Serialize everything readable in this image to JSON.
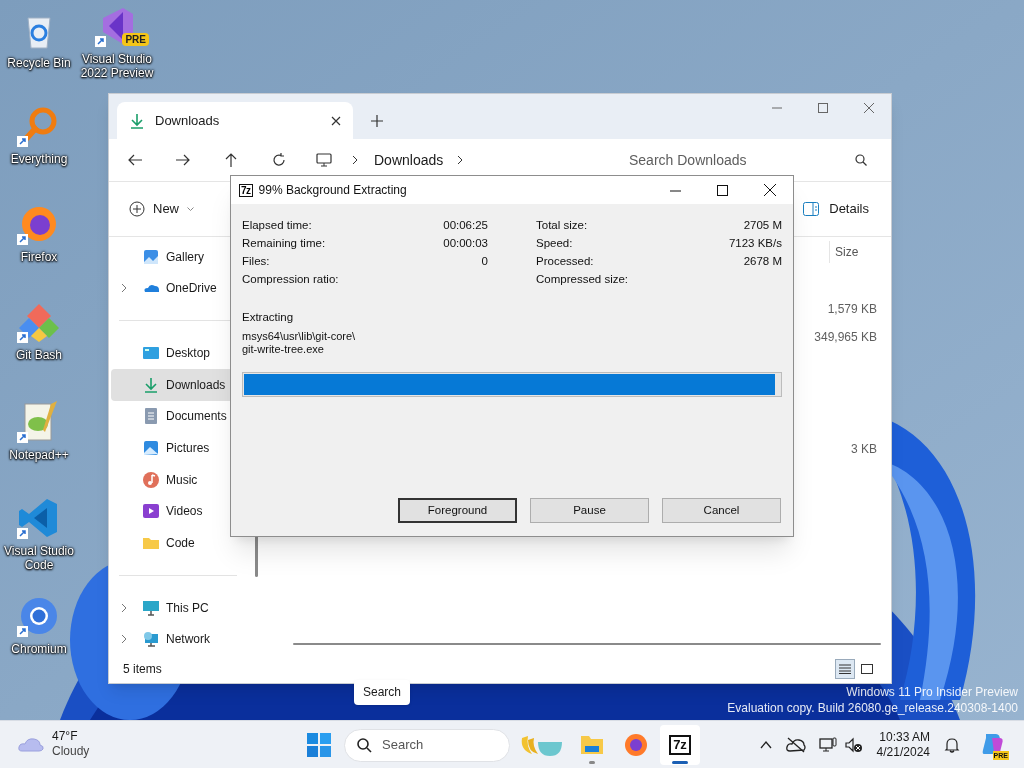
{
  "desktop": {
    "icons": [
      {
        "kind": "recycle",
        "label": "Recycle Bin"
      },
      {
        "kind": "vs",
        "label": "Visual Studio 2022 Preview",
        "badge": "PRE"
      },
      {
        "kind": "everything",
        "label": "Everything"
      },
      {
        "kind": "firefox",
        "label": "Firefox"
      },
      {
        "kind": "gitbash",
        "label": "Git Bash"
      },
      {
        "kind": "notepad",
        "label": "Notepad++"
      },
      {
        "kind": "vscode",
        "label": "Visual Studio Code"
      },
      {
        "kind": "chromium",
        "label": "Chromium"
      }
    ],
    "watermark": [
      "Windows 11 Pro Insider Preview",
      "Evaluation copy. Build 26080.ge_release.240308-1400"
    ],
    "tooltip": "Search"
  },
  "explorer": {
    "tab": {
      "label": "Downloads"
    },
    "address": {
      "crumb": "Downloads"
    },
    "search": {
      "placeholder": "Search Downloads"
    },
    "toolbar": {
      "new_label": "New",
      "view_label": "Details"
    },
    "nav_sections": [
      {
        "items": [
          {
            "kind": "gallery",
            "label": "Gallery",
            "expandable": false,
            "selected": false
          },
          {
            "kind": "onedrive",
            "label": "OneDrive",
            "expandable": true,
            "selected": false
          }
        ]
      },
      {
        "items": [
          {
            "kind": "desktop",
            "label": "Desktop",
            "expandable": false,
            "selected": false
          },
          {
            "kind": "downloads",
            "label": "Downloads",
            "expandable": false,
            "selected": true
          },
          {
            "kind": "documents",
            "label": "Documents",
            "expandable": false,
            "selected": false
          },
          {
            "kind": "pictures",
            "label": "Pictures",
            "expandable": false,
            "selected": false
          },
          {
            "kind": "music",
            "label": "Music",
            "expandable": false,
            "selected": false
          },
          {
            "kind": "videos",
            "label": "Videos",
            "expandable": false,
            "selected": false
          },
          {
            "kind": "folder",
            "label": "Code",
            "expandable": false,
            "selected": false
          }
        ]
      },
      {
        "items": [
          {
            "kind": "pc",
            "label": "This PC",
            "expandable": true,
            "selected": false
          },
          {
            "kind": "network",
            "label": "Network",
            "expandable": true,
            "selected": false
          }
        ]
      }
    ],
    "columns": [
      "Size"
    ],
    "rows": [
      {},
      {
        "size": "1,579 KB"
      },
      {
        "size": "349,965 KB"
      },
      {},
      {},
      {},
      {
        "size": "3 KB"
      }
    ],
    "status": "5 items"
  },
  "dialog": {
    "icon_text": "7z",
    "title": "99% Background Extracting",
    "stats_left": [
      {
        "label": "Elapsed time:",
        "value": "00:06:25"
      },
      {
        "label": "Remaining time:",
        "value": "00:00:03"
      },
      {
        "label": "Files:",
        "value": "0"
      },
      {
        "label": "Compression ratio:"
      }
    ],
    "stats_right": [
      {
        "label": "Total size:",
        "value": "2705 M"
      },
      {
        "label": "Speed:",
        "value": "7123 KB/s"
      },
      {
        "label": "Processed:",
        "value": "2678 M"
      },
      {
        "label": "Compressed size:"
      }
    ],
    "section_label": "Extracting",
    "path_lines": [
      "msys64\\usr\\lib\\git-core\\",
      "git-write-tree.exe"
    ],
    "progress": {
      "level": 0.99
    },
    "buttons": [
      {
        "label": "Foreground",
        "default": true
      },
      {
        "label": "Pause",
        "default": false
      },
      {
        "label": "Cancel",
        "default": false
      }
    ]
  },
  "taskbar": {
    "weather": {
      "temp": "47°F",
      "condition": "Cloudy"
    },
    "search": {
      "placeholder": "Search"
    },
    "apps": [
      {
        "kind": "widget",
        "active": false,
        "running": false
      },
      {
        "kind": "explorer",
        "active": false,
        "running": true
      },
      {
        "kind": "firefox",
        "active": false,
        "running": false
      },
      {
        "kind": "sevenzip",
        "text": "7z",
        "active": true,
        "running": true
      }
    ],
    "time": "10:33 AM",
    "date": "4/21/2024",
    "copilot_badge": "PRE"
  }
}
